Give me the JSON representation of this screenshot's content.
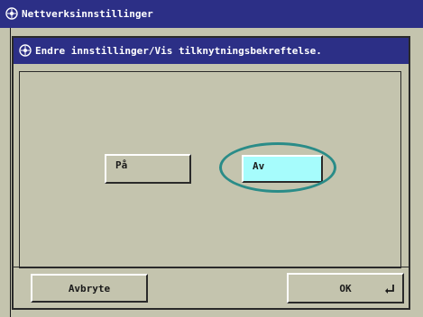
{
  "titlebar": {
    "title": "Nettverksinnstillinger",
    "icon": "network-settings-icon"
  },
  "dialog": {
    "header": "Endre innstillinger/Vis tilknytningsbekreftelse.",
    "header_icon": "network-settings-icon",
    "options": [
      {
        "label": "På",
        "selected": false
      },
      {
        "label": "Av",
        "selected": true
      }
    ]
  },
  "footer": {
    "cancel_label": "Avbryte",
    "ok_label": "OK",
    "ok_icon": "enter-icon"
  },
  "colors": {
    "background": "#c4c4ae",
    "titlebar": "#2c2f86",
    "selected_button": "#a6fcfc",
    "highlight_ring": "#2a8c88"
  }
}
